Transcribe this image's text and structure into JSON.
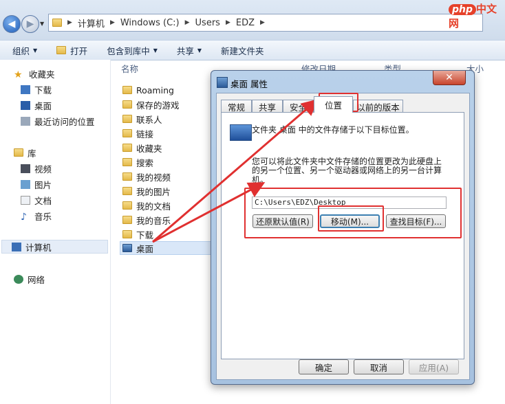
{
  "logo": {
    "php": "php",
    "cn": "中文网"
  },
  "address": {
    "crumbs": [
      "计算机",
      "Windows (C:)",
      "Users",
      "EDZ"
    ]
  },
  "toolbar": {
    "organize": "组织",
    "open": "打开",
    "include_library": "包含到库中",
    "share": "共享",
    "new_folder": "新建文件夹"
  },
  "sidebar": {
    "favorites": "收藏夹",
    "favorites_items": [
      "下载",
      "桌面",
      "最近访问的位置"
    ],
    "libraries": "库",
    "library_items": [
      "视频",
      "图片",
      "文档",
      "音乐"
    ],
    "computer": "计算机",
    "network": "网络"
  },
  "columns": {
    "name": "名称",
    "modified": "修改日期",
    "type": "类型",
    "size": "大小"
  },
  "files": [
    "Roaming",
    "保存的游戏",
    "联系人",
    "链接",
    "收藏夹",
    "搜索",
    "我的视频",
    "我的图片",
    "我的文档",
    "我的音乐",
    "下载",
    "桌面"
  ],
  "dialog": {
    "title": "桌面 属性",
    "close": "✕",
    "tabs": [
      "常规",
      "共享",
      "安全",
      "位置",
      "以前的版本"
    ],
    "description": "文件夹 桌面 中的文件存储于以下目标位置。",
    "move_hint_line1": "您可以将此文件夹中文件存储的位置更改为此硬盘上",
    "move_hint_line2": "的另一个位置、另一个驱动器或网络上的另一台计算",
    "move_hint_line3": "机。",
    "path": "C:\\Users\\EDZ\\Desktop",
    "restore_default": "还原默认值(R)",
    "move": "移动(M)...",
    "find_target": "查找目标(F)...",
    "ok": "确定",
    "cancel": "取消",
    "apply": "应用(A)"
  },
  "colors": {
    "highlight": "#e03030",
    "arrow": "#e03030"
  }
}
